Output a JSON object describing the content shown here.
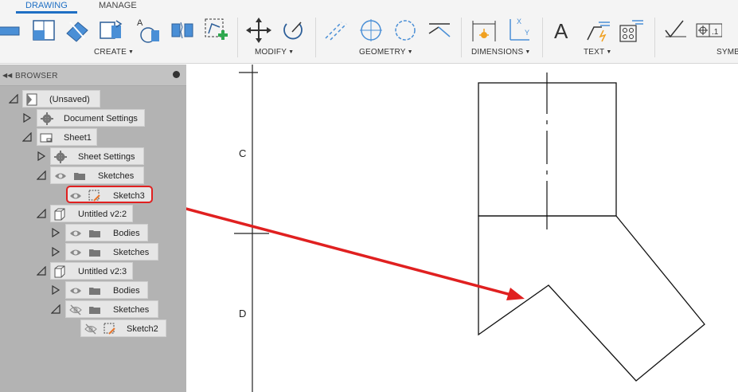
{
  "ribbon": {
    "tabs": [
      {
        "label": "DRAWING",
        "active": true
      },
      {
        "label": "MANAGE",
        "active": false
      }
    ],
    "groups": {
      "create": "CREATE",
      "modify": "MODIFY",
      "geometry": "GEOMETRY",
      "dimensions": "DIMENSIONS",
      "text": "TEXT",
      "symbols": "SYMB"
    },
    "accent_color": "#1f6fc4"
  },
  "browser": {
    "title": "BROWSER",
    "items": [
      {
        "label": "(Unsaved)",
        "icon": "document-icon"
      },
      {
        "label": "Document Settings",
        "icon": "gear-icon"
      },
      {
        "label": "Sheet1",
        "icon": "sheet-icon"
      },
      {
        "label": "Sheet Settings",
        "icon": "gear-icon"
      },
      {
        "label": "Sketches",
        "icon": "folder-icon"
      },
      {
        "label": "Sketch3",
        "icon": "sketch-icon",
        "highlighted": true
      },
      {
        "label": "Untitled v2:2",
        "icon": "component-icon"
      },
      {
        "label": "Bodies",
        "icon": "folder-icon"
      },
      {
        "label": "Sketches",
        "icon": "folder-icon"
      },
      {
        "label": "Untitled v2:3",
        "icon": "component-icon"
      },
      {
        "label": "Bodies",
        "icon": "folder-icon"
      },
      {
        "label": "Sketches",
        "icon": "folder-icon",
        "hidden": true
      },
      {
        "label": "Sketch2",
        "icon": "sketch-icon",
        "hidden": true
      }
    ]
  },
  "canvas": {
    "zone_labels": [
      "C",
      "D"
    ],
    "annotation_color": "#e02020"
  }
}
